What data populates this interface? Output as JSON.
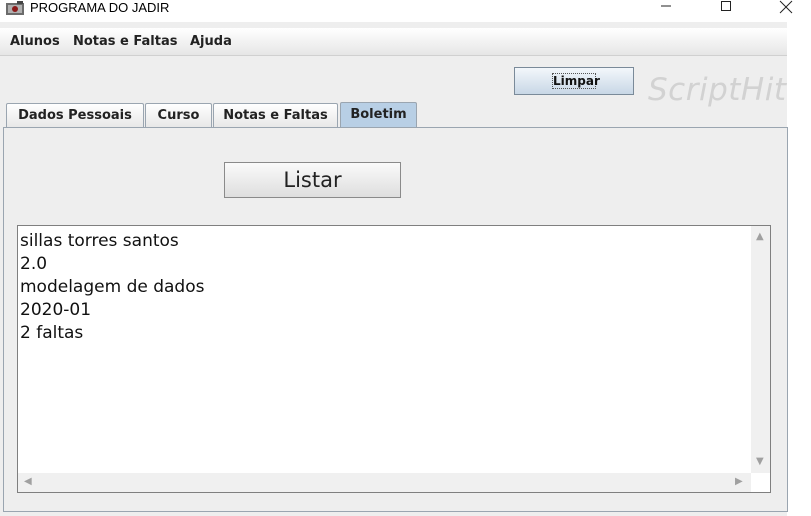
{
  "window": {
    "title": "PROGRAMA DO JADIR"
  },
  "menu": [
    {
      "label": "Alunos"
    },
    {
      "label": "Notas e Faltas"
    },
    {
      "label": "Ajuda"
    }
  ],
  "toolbar": {
    "limpar_label": "Limpar",
    "watermark": "ScriptHit"
  },
  "tabs": [
    {
      "label": "Dados Pessoais"
    },
    {
      "label": "Curso"
    },
    {
      "label": "Notas e Faltas"
    },
    {
      "label": "Boletim",
      "active": true
    }
  ],
  "boletim": {
    "listar_label": "Listar",
    "output_lines": [
      "sillas torres santos",
      "2.0",
      "modelagem de dados",
      "2020-01",
      "2 faltas"
    ]
  },
  "colors": {
    "active_tab": "#b8cfe5",
    "watermark": "#d2d2d2"
  }
}
